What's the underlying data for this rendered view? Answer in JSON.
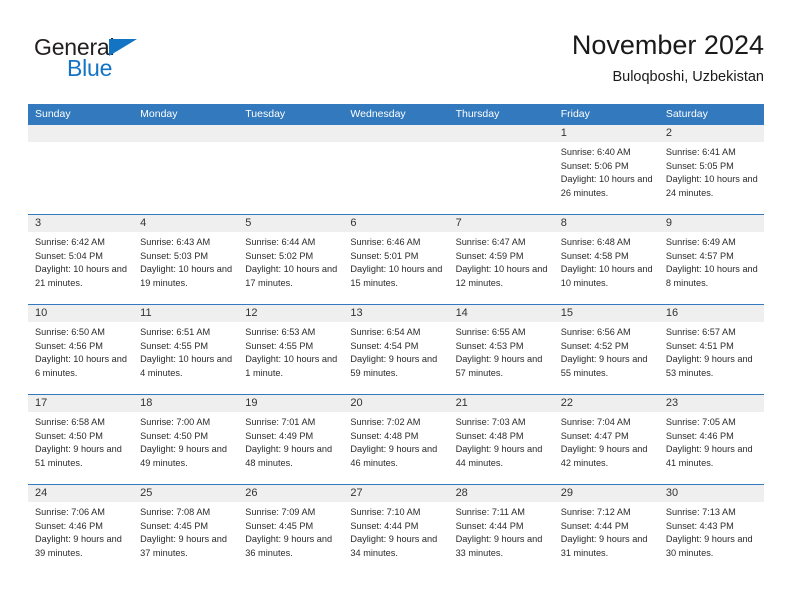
{
  "brand": {
    "name_part1": "General",
    "name_part2": "Blue",
    "triangle_color": "#1474c4",
    "text_color": "#231f20"
  },
  "header": {
    "title": "November 2024",
    "subtitle": "Buloqboshi, Uzbekistan"
  },
  "theme": {
    "header_blue": "#3379bd",
    "day_strip_gray": "#efefef",
    "text_color": "#2b2b2b"
  },
  "weekday_headers": [
    "Sunday",
    "Monday",
    "Tuesday",
    "Wednesday",
    "Thursday",
    "Friday",
    "Saturday"
  ],
  "labels": {
    "sunrise": "Sunrise:",
    "sunset": "Sunset:",
    "daylight": "Daylight:"
  },
  "weeks": [
    [
      {
        "day": "",
        "sunrise": "",
        "sunset": "",
        "daylight": "",
        "empty": true
      },
      {
        "day": "",
        "sunrise": "",
        "sunset": "",
        "daylight": "",
        "empty": true
      },
      {
        "day": "",
        "sunrise": "",
        "sunset": "",
        "daylight": "",
        "empty": true
      },
      {
        "day": "",
        "sunrise": "",
        "sunset": "",
        "daylight": "",
        "empty": true
      },
      {
        "day": "",
        "sunrise": "",
        "sunset": "",
        "daylight": "",
        "empty": true
      },
      {
        "day": "1",
        "sunrise": "Sunrise: 6:40 AM",
        "sunset": "Sunset: 5:06 PM",
        "daylight": "Daylight: 10 hours and 26 minutes."
      },
      {
        "day": "2",
        "sunrise": "Sunrise: 6:41 AM",
        "sunset": "Sunset: 5:05 PM",
        "daylight": "Daylight: 10 hours and 24 minutes."
      }
    ],
    [
      {
        "day": "3",
        "sunrise": "Sunrise: 6:42 AM",
        "sunset": "Sunset: 5:04 PM",
        "daylight": "Daylight: 10 hours and 21 minutes."
      },
      {
        "day": "4",
        "sunrise": "Sunrise: 6:43 AM",
        "sunset": "Sunset: 5:03 PM",
        "daylight": "Daylight: 10 hours and 19 minutes."
      },
      {
        "day": "5",
        "sunrise": "Sunrise: 6:44 AM",
        "sunset": "Sunset: 5:02 PM",
        "daylight": "Daylight: 10 hours and 17 minutes."
      },
      {
        "day": "6",
        "sunrise": "Sunrise: 6:46 AM",
        "sunset": "Sunset: 5:01 PM",
        "daylight": "Daylight: 10 hours and 15 minutes."
      },
      {
        "day": "7",
        "sunrise": "Sunrise: 6:47 AM",
        "sunset": "Sunset: 4:59 PM",
        "daylight": "Daylight: 10 hours and 12 minutes."
      },
      {
        "day": "8",
        "sunrise": "Sunrise: 6:48 AM",
        "sunset": "Sunset: 4:58 PM",
        "daylight": "Daylight: 10 hours and 10 minutes."
      },
      {
        "day": "9",
        "sunrise": "Sunrise: 6:49 AM",
        "sunset": "Sunset: 4:57 PM",
        "daylight": "Daylight: 10 hours and 8 minutes."
      }
    ],
    [
      {
        "day": "10",
        "sunrise": "Sunrise: 6:50 AM",
        "sunset": "Sunset: 4:56 PM",
        "daylight": "Daylight: 10 hours and 6 minutes."
      },
      {
        "day": "11",
        "sunrise": "Sunrise: 6:51 AM",
        "sunset": "Sunset: 4:55 PM",
        "daylight": "Daylight: 10 hours and 4 minutes."
      },
      {
        "day": "12",
        "sunrise": "Sunrise: 6:53 AM",
        "sunset": "Sunset: 4:55 PM",
        "daylight": "Daylight: 10 hours and 1 minute."
      },
      {
        "day": "13",
        "sunrise": "Sunrise: 6:54 AM",
        "sunset": "Sunset: 4:54 PM",
        "daylight": "Daylight: 9 hours and 59 minutes."
      },
      {
        "day": "14",
        "sunrise": "Sunrise: 6:55 AM",
        "sunset": "Sunset: 4:53 PM",
        "daylight": "Daylight: 9 hours and 57 minutes."
      },
      {
        "day": "15",
        "sunrise": "Sunrise: 6:56 AM",
        "sunset": "Sunset: 4:52 PM",
        "daylight": "Daylight: 9 hours and 55 minutes."
      },
      {
        "day": "16",
        "sunrise": "Sunrise: 6:57 AM",
        "sunset": "Sunset: 4:51 PM",
        "daylight": "Daylight: 9 hours and 53 minutes."
      }
    ],
    [
      {
        "day": "17",
        "sunrise": "Sunrise: 6:58 AM",
        "sunset": "Sunset: 4:50 PM",
        "daylight": "Daylight: 9 hours and 51 minutes."
      },
      {
        "day": "18",
        "sunrise": "Sunrise: 7:00 AM",
        "sunset": "Sunset: 4:50 PM",
        "daylight": "Daylight: 9 hours and 49 minutes."
      },
      {
        "day": "19",
        "sunrise": "Sunrise: 7:01 AM",
        "sunset": "Sunset: 4:49 PM",
        "daylight": "Daylight: 9 hours and 48 minutes."
      },
      {
        "day": "20",
        "sunrise": "Sunrise: 7:02 AM",
        "sunset": "Sunset: 4:48 PM",
        "daylight": "Daylight: 9 hours and 46 minutes."
      },
      {
        "day": "21",
        "sunrise": "Sunrise: 7:03 AM",
        "sunset": "Sunset: 4:48 PM",
        "daylight": "Daylight: 9 hours and 44 minutes."
      },
      {
        "day": "22",
        "sunrise": "Sunrise: 7:04 AM",
        "sunset": "Sunset: 4:47 PM",
        "daylight": "Daylight: 9 hours and 42 minutes."
      },
      {
        "day": "23",
        "sunrise": "Sunrise: 7:05 AM",
        "sunset": "Sunset: 4:46 PM",
        "daylight": "Daylight: 9 hours and 41 minutes."
      }
    ],
    [
      {
        "day": "24",
        "sunrise": "Sunrise: 7:06 AM",
        "sunset": "Sunset: 4:46 PM",
        "daylight": "Daylight: 9 hours and 39 minutes."
      },
      {
        "day": "25",
        "sunrise": "Sunrise: 7:08 AM",
        "sunset": "Sunset: 4:45 PM",
        "daylight": "Daylight: 9 hours and 37 minutes."
      },
      {
        "day": "26",
        "sunrise": "Sunrise: 7:09 AM",
        "sunset": "Sunset: 4:45 PM",
        "daylight": "Daylight: 9 hours and 36 minutes."
      },
      {
        "day": "27",
        "sunrise": "Sunrise: 7:10 AM",
        "sunset": "Sunset: 4:44 PM",
        "daylight": "Daylight: 9 hours and 34 minutes."
      },
      {
        "day": "28",
        "sunrise": "Sunrise: 7:11 AM",
        "sunset": "Sunset: 4:44 PM",
        "daylight": "Daylight: 9 hours and 33 minutes."
      },
      {
        "day": "29",
        "sunrise": "Sunrise: 7:12 AM",
        "sunset": "Sunset: 4:44 PM",
        "daylight": "Daylight: 9 hours and 31 minutes."
      },
      {
        "day": "30",
        "sunrise": "Sunrise: 7:13 AM",
        "sunset": "Sunset: 4:43 PM",
        "daylight": "Daylight: 9 hours and 30 minutes."
      }
    ]
  ]
}
